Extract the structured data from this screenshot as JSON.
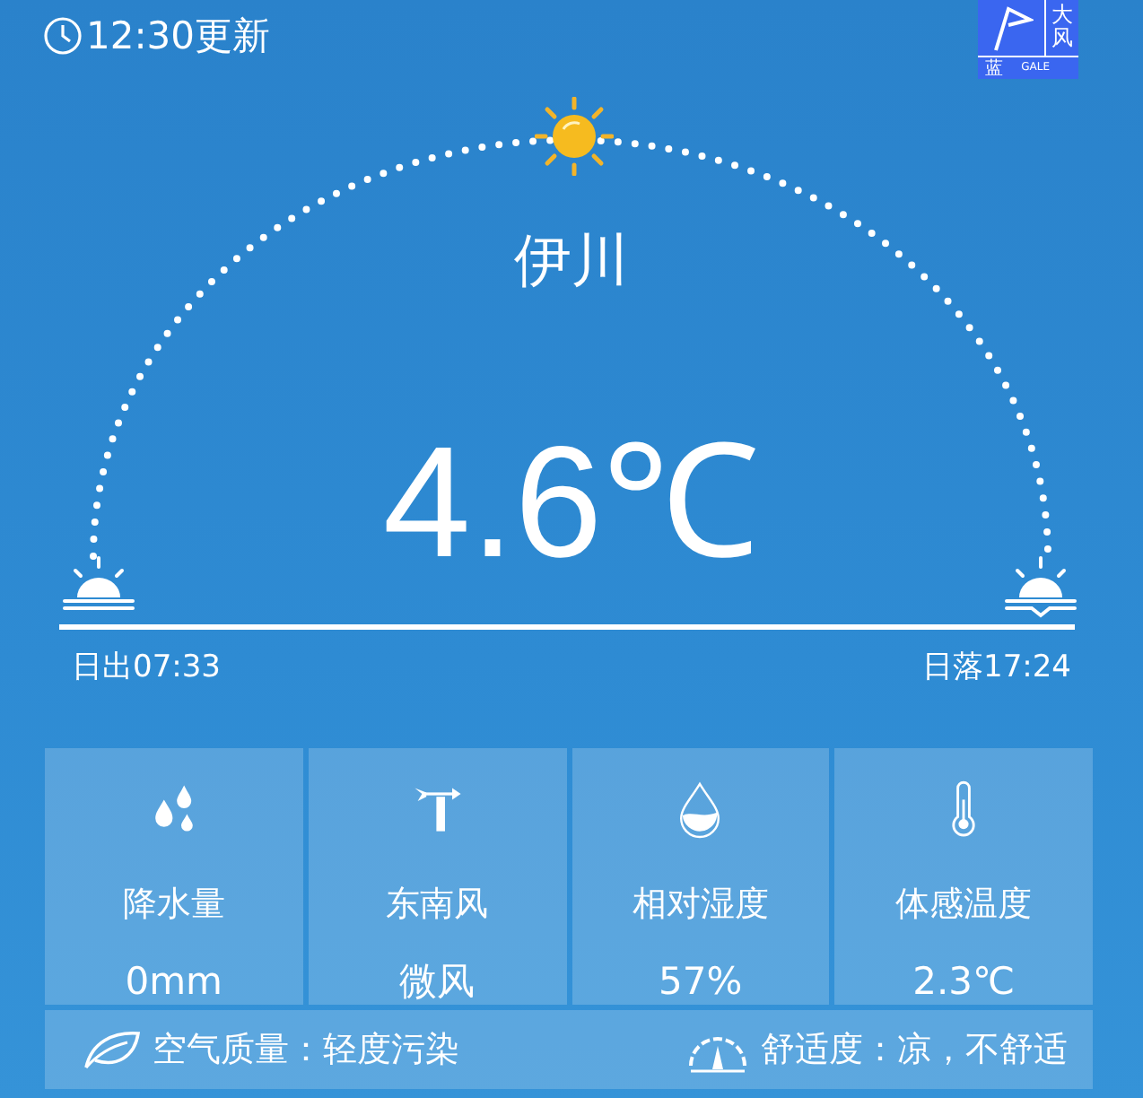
{
  "header": {
    "update_time": "12:30更新"
  },
  "warning": {
    "title": "大风",
    "level": "蓝",
    "label": "GALE"
  },
  "city": "伊川",
  "temperature": "4.6℃",
  "sun": {
    "sunrise": "日出07:33",
    "sunset": "日落17:24"
  },
  "stats": [
    {
      "kind": "rain",
      "label": "降水量",
      "value": "0mm"
    },
    {
      "kind": "wind",
      "label": "东南风",
      "value": "微风"
    },
    {
      "kind": "humidity",
      "label": "相对湿度",
      "value": "57%"
    },
    {
      "kind": "feels",
      "label": "体感温度",
      "value": "2.3℃"
    }
  ],
  "footer": {
    "air_quality": "空气质量：轻度污染",
    "comfort": "舒适度：凉，不舒适"
  }
}
